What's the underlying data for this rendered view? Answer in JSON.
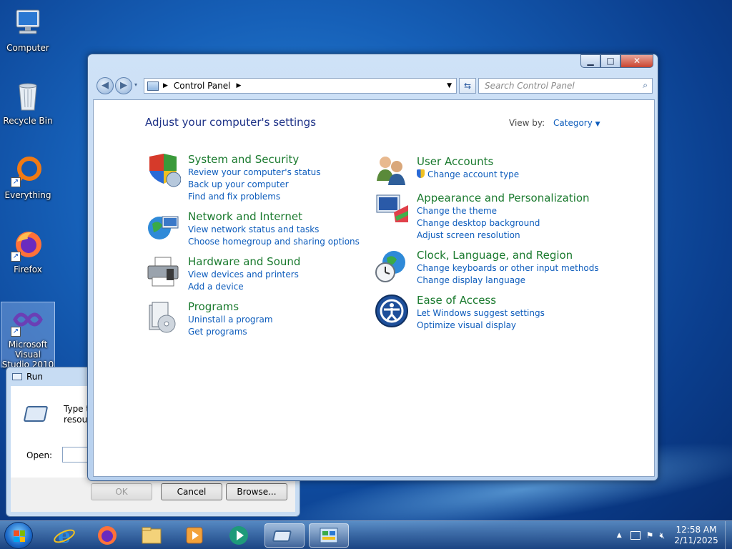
{
  "desktop": {
    "icons": [
      {
        "label": "Computer",
        "icon": "computer-icon"
      },
      {
        "label": "Recycle Bin",
        "icon": "recycle-bin-icon"
      },
      {
        "label": "Everything",
        "icon": "everything-icon"
      },
      {
        "label": "Firefox",
        "icon": "firefox-icon"
      },
      {
        "label": "Microsoft Visual Studio 2010",
        "icon": "visual-studio-icon"
      }
    ]
  },
  "run_dialog": {
    "title": "Run",
    "prompt": "Type the name of a program, folder, document, or Internet resource, and Windows will open it for you.",
    "prompt_visible_line1": "Type the",
    "prompt_visible_line2": "resource",
    "open_label": "Open:",
    "open_value": "",
    "buttons": {
      "ok": "OK",
      "cancel": "Cancel",
      "browse": "Browse..."
    }
  },
  "control_panel": {
    "breadcrumb": [
      "Control Panel"
    ],
    "search_placeholder": "Search Control Panel",
    "heading": "Adjust your computer's settings",
    "view_by_label": "View by:",
    "view_by_value": "Category",
    "categories_left": [
      {
        "title": "System and Security",
        "icon": "shield-icon",
        "links": [
          "Review your computer's status",
          "Back up your computer",
          "Find and fix problems"
        ]
      },
      {
        "title": "Network and Internet",
        "icon": "network-globe-icon",
        "links": [
          "View network status and tasks",
          "Choose homegroup and sharing options"
        ]
      },
      {
        "title": "Hardware and Sound",
        "icon": "printer-icon",
        "links": [
          "View devices and printers",
          "Add a device"
        ]
      },
      {
        "title": "Programs",
        "icon": "programs-icon",
        "links": [
          "Uninstall a program",
          "Get programs"
        ]
      }
    ],
    "categories_right": [
      {
        "title": "User Accounts",
        "icon": "users-icon",
        "links": [
          "Change account type"
        ]
      },
      {
        "title": "Appearance and Personalization",
        "icon": "appearance-icon",
        "links": [
          "Change the theme",
          "Change desktop background",
          "Adjust screen resolution"
        ]
      },
      {
        "title": "Clock, Language, and Region",
        "icon": "clock-globe-icon",
        "links": [
          "Change keyboards or other input methods",
          "Change display language"
        ]
      },
      {
        "title": "Ease of Access",
        "icon": "ease-of-access-icon",
        "links": [
          "Let Windows suggest settings",
          "Optimize visual display"
        ]
      }
    ]
  },
  "taskbar": {
    "items": [
      "start-orb",
      "internet-explorer-icon",
      "firefox-icon",
      "file-explorer-icon",
      "media-player-icon",
      "media-center-icon",
      "run-dialog-icon",
      "control-panel-icon"
    ],
    "time": "12:58 AM",
    "date": "2/11/2025"
  },
  "colors": {
    "link": "#0d5cbc",
    "category_title": "#1a7a2e",
    "heading": "#1e3287"
  }
}
